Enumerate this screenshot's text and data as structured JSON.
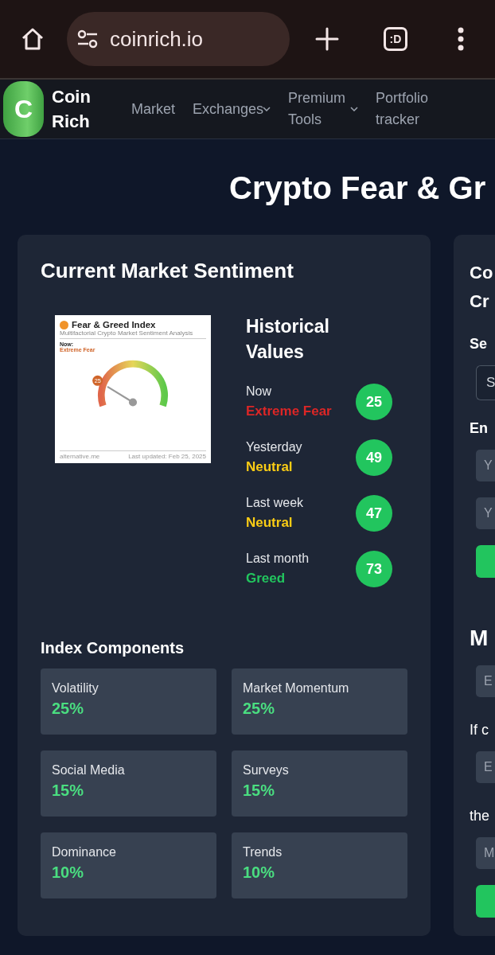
{
  "browser": {
    "url": "coinrich.io",
    "tab_badge": ":D"
  },
  "nav": {
    "brand": [
      "Coin",
      "Rich"
    ],
    "logo_letter": "C",
    "items": [
      {
        "label": "Market",
        "has_menu": false
      },
      {
        "label": "Exchanges",
        "has_menu": true
      },
      {
        "label": "Premium Tools",
        "has_menu": true
      },
      {
        "label": "Portfolio tracker",
        "has_menu": false
      }
    ]
  },
  "page_title": "Crypto Fear & Gr",
  "sentiment_card": {
    "title": "Current Market Sentiment",
    "gauge_image": {
      "title": "Fear & Greed Index",
      "subtitle": "Multifactorial Crypto Market Sentiment Analysis",
      "now_label": "Now:",
      "now_value": "Extreme Fear",
      "value": "25",
      "level": 0.25,
      "source": "alternative.me",
      "updated": "Last updated: Feb 25, 2025"
    },
    "historical": {
      "title": "Historical Values",
      "rows": [
        {
          "period": "Now",
          "label": "Extreme Fear",
          "color": "#dc2626",
          "value": "25"
        },
        {
          "period": "Yesterday",
          "label": "Neutral",
          "color": "#facc15",
          "value": "49"
        },
        {
          "period": "Last week",
          "label": "Neutral",
          "color": "#facc15",
          "value": "47"
        },
        {
          "period": "Last month",
          "label": "Greed",
          "color": "#22c55e",
          "value": "73"
        }
      ]
    },
    "components": {
      "title": "Index Components",
      "items": [
        {
          "name": "Volatility",
          "share": "25%"
        },
        {
          "name": "Market Momentum",
          "share": "25%"
        },
        {
          "name": "Social Media",
          "share": "15%"
        },
        {
          "name": "Surveys",
          "share": "15%"
        },
        {
          "name": "Dominance",
          "share": "10%"
        },
        {
          "name": "Trends",
          "share": "10%"
        }
      ]
    }
  },
  "side_card": {
    "title_lines": [
      "Co",
      "Cr"
    ],
    "blocks": [
      {
        "kind": "label",
        "text": "Se"
      },
      {
        "kind": "select",
        "value": "S"
      },
      {
        "kind": "label",
        "text": "En"
      },
      {
        "kind": "input",
        "placeholder": "Y"
      },
      {
        "kind": "input",
        "placeholder": "Y"
      },
      {
        "kind": "button"
      },
      {
        "kind": "heading",
        "text": "M"
      },
      {
        "kind": "input",
        "placeholder": "E"
      },
      {
        "kind": "text",
        "text": "If c"
      },
      {
        "kind": "input",
        "placeholder": "E"
      },
      {
        "kind": "text",
        "text": "the"
      },
      {
        "kind": "input",
        "placeholder": "M"
      },
      {
        "kind": "button"
      }
    ]
  }
}
